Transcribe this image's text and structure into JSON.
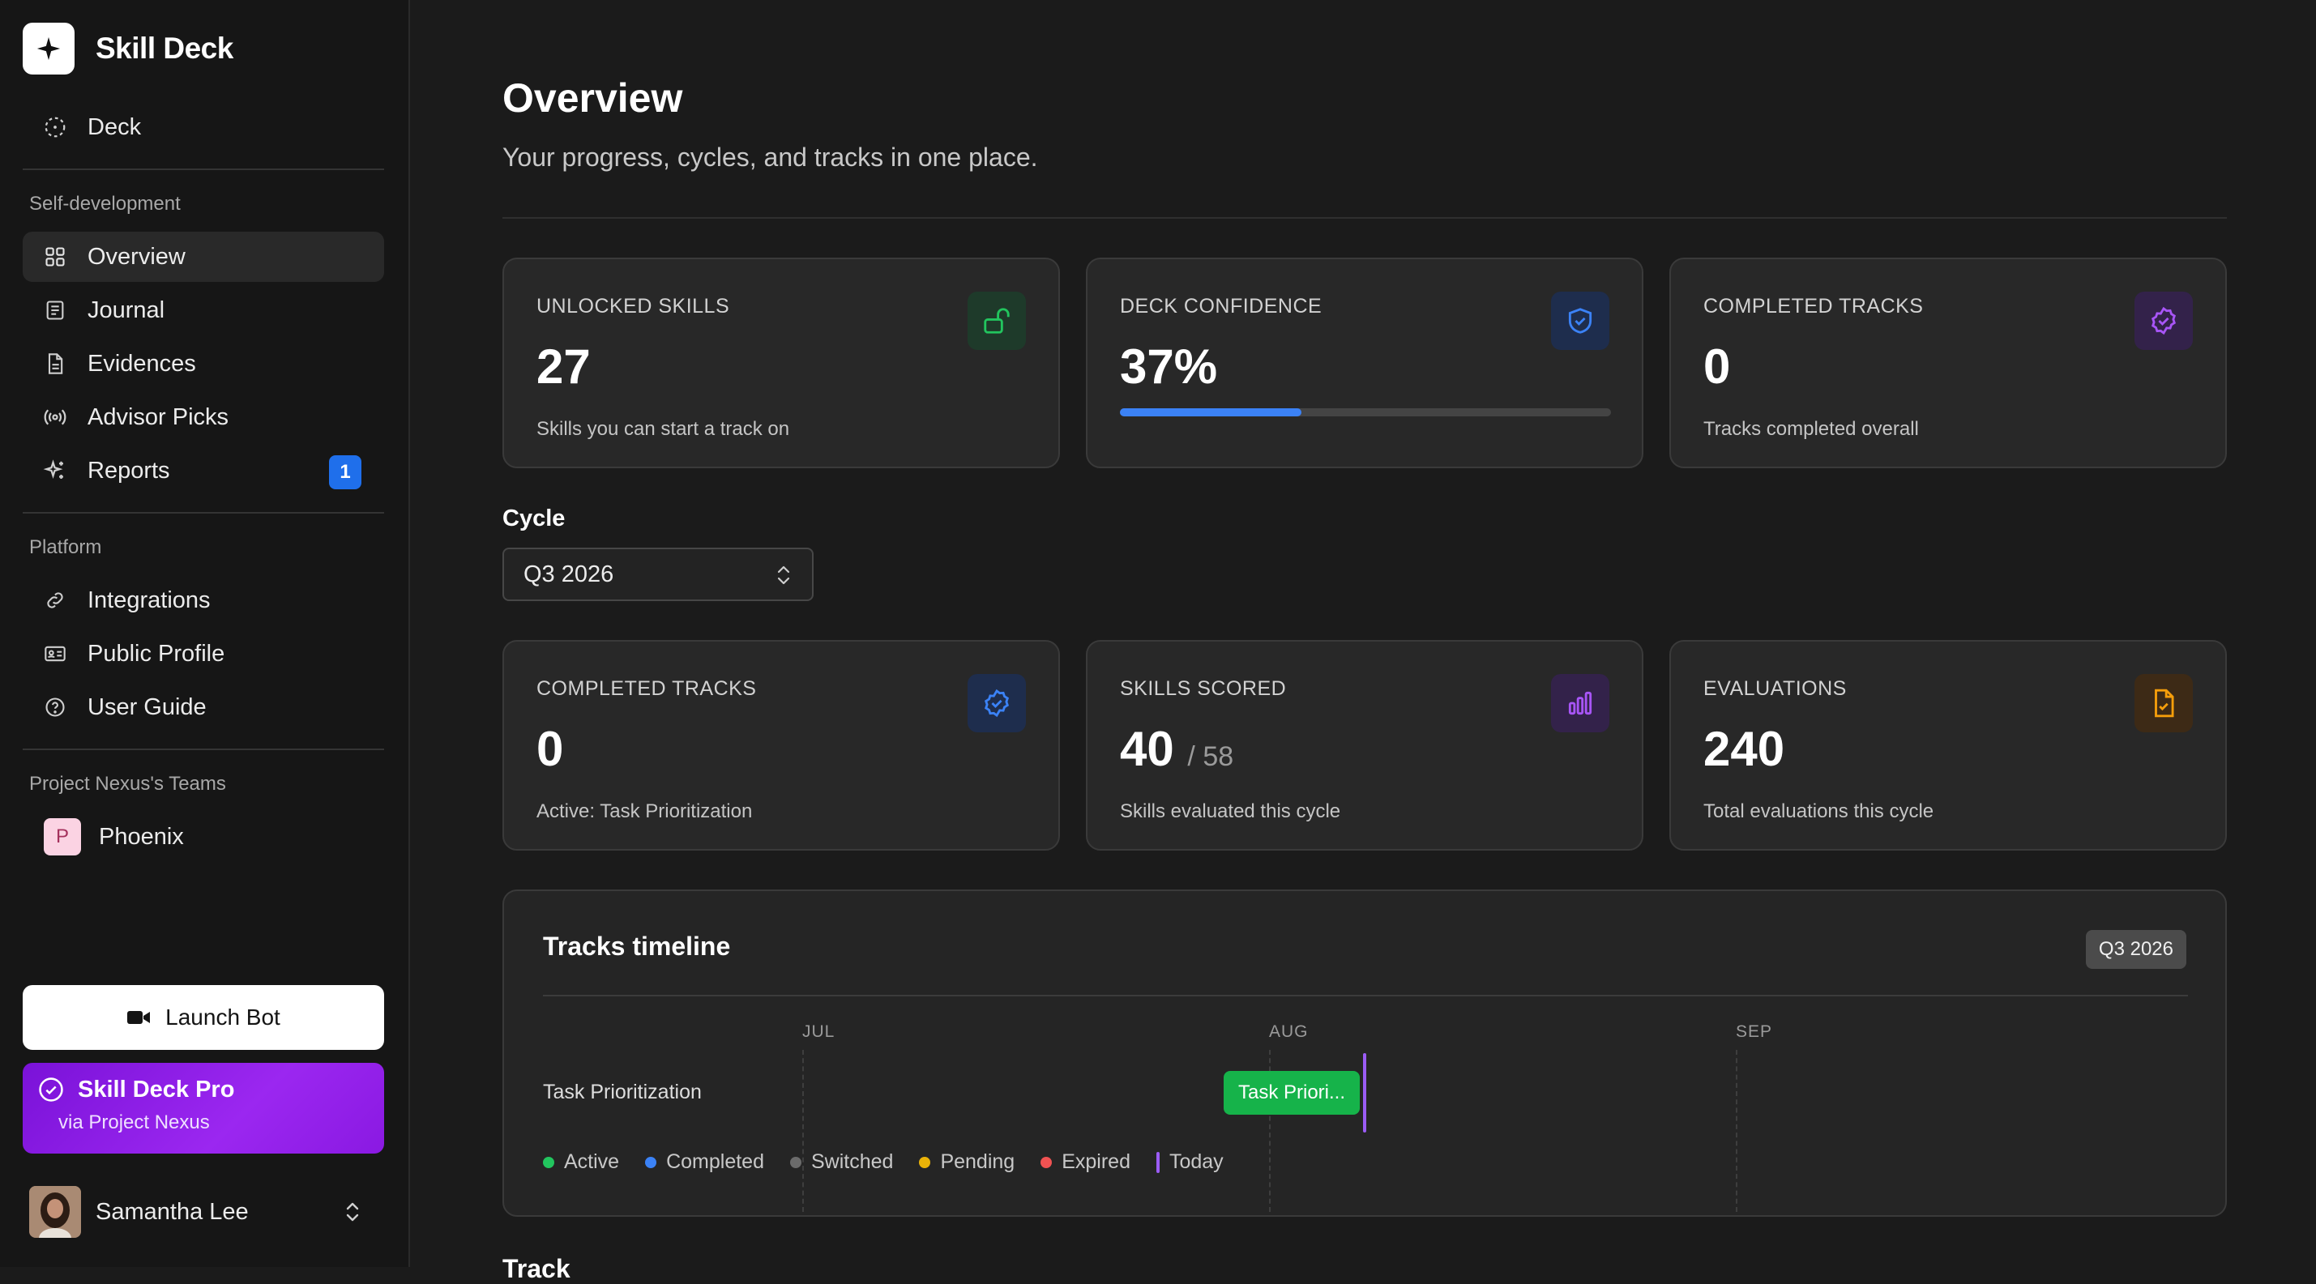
{
  "brand": {
    "name": "Skill Deck"
  },
  "sidebar": {
    "top_item": {
      "label": "Deck",
      "icon": "dashed-circle-icon"
    },
    "sections": [
      {
        "title": "Self-development",
        "items": [
          {
            "label": "Overview",
            "icon": "grid-icon",
            "active": true
          },
          {
            "label": "Journal",
            "icon": "journal-icon"
          },
          {
            "label": "Evidences",
            "icon": "document-icon"
          },
          {
            "label": "Advisor Picks",
            "icon": "broadcast-icon"
          },
          {
            "label": "Reports",
            "icon": "sparkles-icon",
            "badge": "1"
          }
        ]
      },
      {
        "title": "Platform",
        "items": [
          {
            "label": "Integrations",
            "icon": "link-icon"
          },
          {
            "label": "Public Profile",
            "icon": "id-card-icon"
          },
          {
            "label": "User Guide",
            "icon": "help-circle-icon"
          }
        ]
      },
      {
        "title": "Project Nexus's Teams",
        "items": [
          {
            "label": "Phoenix",
            "avatar_letter": "P"
          }
        ]
      }
    ],
    "launch_button": "Launch Bot",
    "pro": {
      "title": "Skill Deck Pro",
      "subtitle": "via Project Nexus"
    },
    "user": {
      "name": "Samantha Lee"
    }
  },
  "main": {
    "title": "Overview",
    "subtitle": "Your progress, cycles, and tracks in one place.",
    "top_cards": [
      {
        "label": "UNLOCKED SKILLS",
        "value": "27",
        "desc": "Skills you can start a track on",
        "icon": "unlock-icon",
        "color": "#22c55e"
      },
      {
        "label": "DECK CONFIDENCE",
        "value": "37%",
        "progress": 0.37,
        "icon": "shield-check-icon",
        "color": "#3b82f6"
      },
      {
        "label": "COMPLETED TRACKS",
        "value": "0",
        "desc": "Tracks completed overall",
        "icon": "badge-check-icon",
        "color": "#a855f7"
      }
    ],
    "cycle": {
      "label": "Cycle",
      "selected": "Q3 2026"
    },
    "cycle_cards": [
      {
        "label": "COMPLETED TRACKS",
        "value": "0",
        "desc": "Active: Task Prioritization",
        "icon": "badge-check-icon",
        "color": "#3b82f6"
      },
      {
        "label": "SKILLS SCORED",
        "value": "40",
        "of": "/ 58",
        "desc": "Skills evaluated this cycle",
        "icon": "bar-chart-icon",
        "color": "#a855f7"
      },
      {
        "label": "EVALUATIONS",
        "value": "240",
        "desc": "Total evaluations this cycle",
        "icon": "file-check-icon",
        "color": "#f59e0b"
      }
    ],
    "timeline": {
      "title": "Tracks timeline",
      "badge": "Q3 2026",
      "months": [
        "JUL",
        "AUG",
        "SEP"
      ],
      "rows": [
        {
          "label": "Task Prioritization",
          "bar_label": "Task Priori..."
        }
      ],
      "legend": [
        {
          "label": "Active",
          "color": "#22c55e"
        },
        {
          "label": "Completed",
          "color": "#3b82f6"
        },
        {
          "label": "Switched",
          "color": "#6b6b6b"
        },
        {
          "label": "Pending",
          "color": "#eab308"
        },
        {
          "label": "Expired",
          "color": "#f05252"
        },
        {
          "label": "Today",
          "color": "#9b5cf6"
        }
      ]
    },
    "next_section_title": "Track"
  }
}
